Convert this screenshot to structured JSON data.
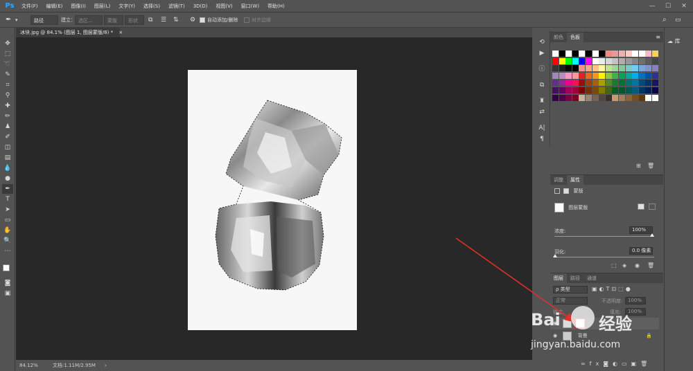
{
  "app": {
    "logo": "Ps"
  },
  "menu": [
    "文件(F)",
    "编辑(E)",
    "图像(I)",
    "图层(L)",
    "文字(Y)",
    "选择(S)",
    "滤镜(T)",
    "3D(D)",
    "视图(V)",
    "窗口(W)",
    "帮助(H)"
  ],
  "window_controls": {
    "minimize": "—",
    "maximize": "☐",
    "close": "✕"
  },
  "options": {
    "mode_value": "路径",
    "build_label": "建立：",
    "selection_btn": "选区...",
    "mask_btn": "蒙版",
    "shape_btn": "形状",
    "auto_add_delete": "自动添加/删除",
    "align_edges": "对齐边缘"
  },
  "document": {
    "tab_title": "冰块.jpg @ 84.1% (图层 1, 图层蒙版/8) *",
    "tab_close": "×"
  },
  "status": {
    "zoom": "84.12%",
    "doc_size": "文档:1.11M/2.95M"
  },
  "panels": {
    "swatches_tabs": [
      "颜色",
      "色板"
    ],
    "properties_tabs": [
      "调整",
      "属性"
    ],
    "properties_mask_label": "蒙版",
    "layer_mask_label": "图层蒙版",
    "density_label": "浓度:",
    "density_value": "100%",
    "feather_label": "羽化:",
    "feather_value": "0.0 像素",
    "layers_tabs": [
      "图层",
      "路径",
      "通道"
    ],
    "layer_kind": "ρ 类型",
    "blend_mode": "正常",
    "opacity_label": "不透明度:",
    "opacity_value": "100%",
    "lock_label": "锁定:",
    "fill_label": "填充:",
    "fill_value": "100%",
    "background_layer": "背景",
    "library_label": "库"
  },
  "watermark": {
    "brand": "Bai",
    "brand2": "经验",
    "url": "jingyan.baidu.com"
  },
  "colors": {
    "accent": "#31a8ff",
    "arrow": "#e0302a"
  }
}
